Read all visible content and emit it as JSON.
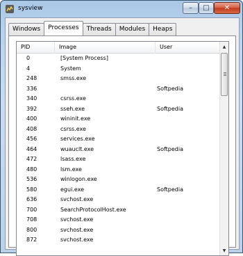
{
  "window": {
    "title": "sysview",
    "min": "–",
    "max": "□",
    "close": "✕"
  },
  "tabs": [
    "Windows",
    "Processes",
    "Threads",
    "Modules",
    "Heaps"
  ],
  "columns": {
    "pid": "PID",
    "image": "Image",
    "user": "User"
  },
  "scroll": {
    "up": "▲",
    "down": "▼"
  },
  "rows": [
    {
      "pid": "0",
      "image": "[System Process]",
      "user": ""
    },
    {
      "pid": "4",
      "image": "System",
      "user": ""
    },
    {
      "pid": "248",
      "image": "smss.exe",
      "user": ""
    },
    {
      "pid": "336",
      "image": "",
      "user": "Softpedia"
    },
    {
      "pid": "340",
      "image": "csrss.exe",
      "user": ""
    },
    {
      "pid": "392",
      "image": "sseh.exe",
      "user": "Softpedia"
    },
    {
      "pid": "400",
      "image": "wininit.exe",
      "user": ""
    },
    {
      "pid": "408",
      "image": "csrss.exe",
      "user": ""
    },
    {
      "pid": "456",
      "image": "services.exe",
      "user": ""
    },
    {
      "pid": "464",
      "image": "wuauclt.exe",
      "user": "Softpedia"
    },
    {
      "pid": "472",
      "image": "lsass.exe",
      "user": ""
    },
    {
      "pid": "480",
      "image": "lsm.exe",
      "user": ""
    },
    {
      "pid": "536",
      "image": "winlogon.exe",
      "user": ""
    },
    {
      "pid": "580",
      "image": "egui.exe",
      "user": "Softpedia"
    },
    {
      "pid": "636",
      "image": "svchost.exe",
      "user": ""
    },
    {
      "pid": "700",
      "image": "SearchProtocolHost.exe",
      "user": ""
    },
    {
      "pid": "708",
      "image": "svchost.exe",
      "user": ""
    },
    {
      "pid": "800",
      "image": "svchost.exe",
      "user": ""
    },
    {
      "pid": "872",
      "image": "svchost.exe",
      "user": ""
    }
  ]
}
